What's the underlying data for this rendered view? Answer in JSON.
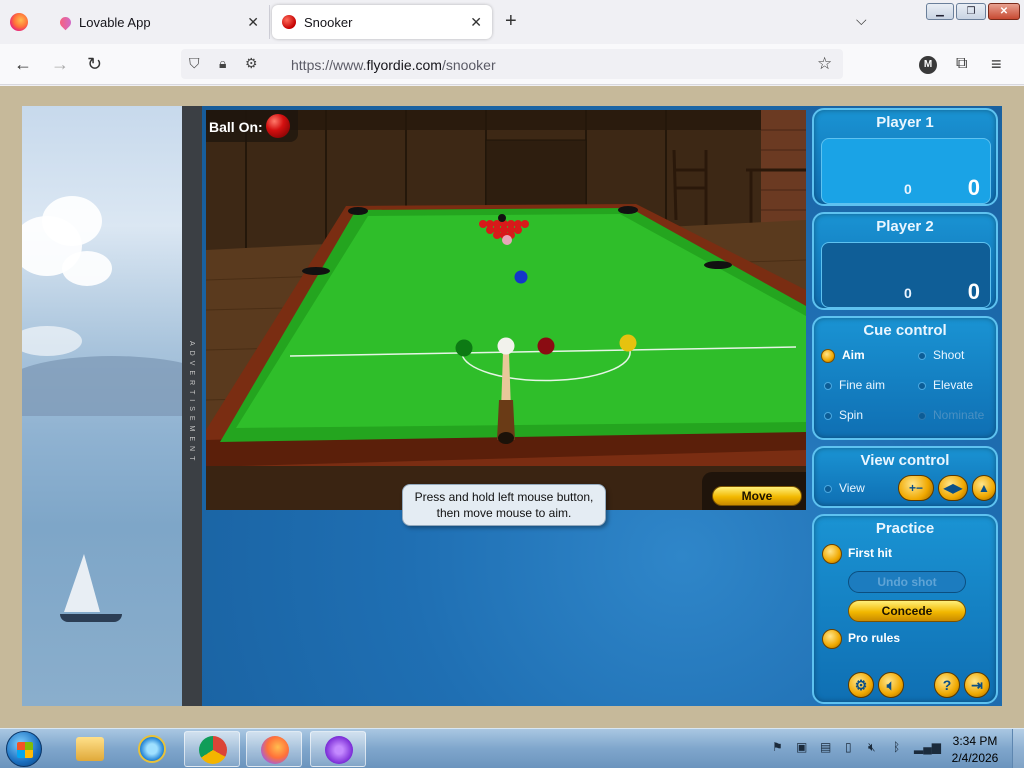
{
  "browser": {
    "tabs": [
      {
        "label": "Lovable App"
      },
      {
        "label": "Snooker"
      }
    ],
    "url": {
      "prefix": "https://www.",
      "domain": "flyordie.com",
      "path": "/snooker"
    },
    "account_initial": "M"
  },
  "ad": {
    "label": "ADVERTISEMENT"
  },
  "game": {
    "ball_on_label": "Ball On:",
    "move_label": "Move",
    "hint": "Press and hold left mouse button, then move mouse to aim.",
    "players": [
      {
        "name": "Player 1",
        "score": "0",
        "break": "0"
      },
      {
        "name": "Player 2",
        "score": "0",
        "break": "0"
      }
    ],
    "cue_control": {
      "title": "Cue control",
      "options": [
        {
          "label": "Aim",
          "state": "selected"
        },
        {
          "label": "Shoot",
          "state": "normal"
        },
        {
          "label": "Fine aim",
          "state": "normal"
        },
        {
          "label": "Elevate",
          "state": "normal"
        },
        {
          "label": "Spin",
          "state": "normal"
        },
        {
          "label": "Nominate",
          "state": "disabled"
        }
      ]
    },
    "view_control": {
      "title": "View control",
      "view_label": "View"
    },
    "practice": {
      "title": "Practice",
      "first_hit": "First hit",
      "undo_shot": "Undo shot",
      "concede": "Concede",
      "pro_rules": "Pro rules"
    },
    "colors": {
      "felt": "#2fbe2a",
      "cushion": "#24a51f",
      "panel": "#1a93d3",
      "gold": "#f2b800"
    }
  },
  "taskbar": {
    "time": "3:34 PM",
    "date": "2/4/2026"
  }
}
